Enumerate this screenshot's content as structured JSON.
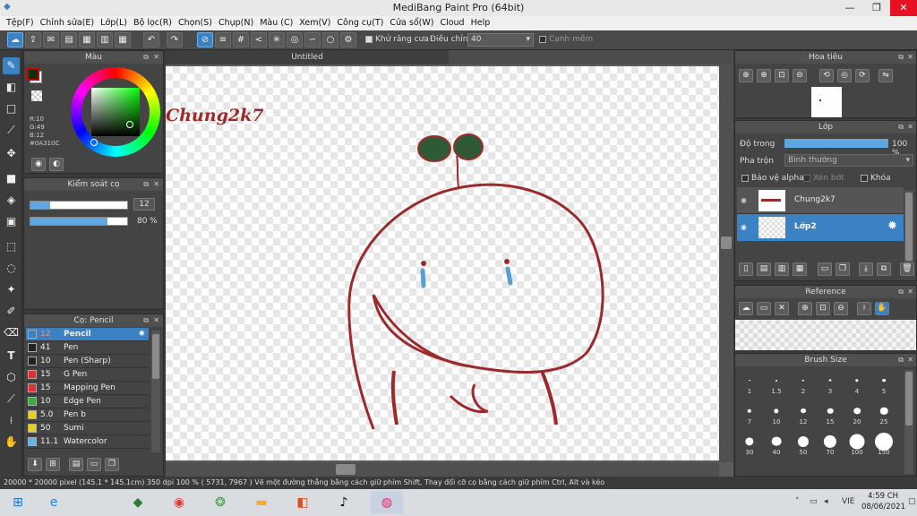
{
  "window": {
    "title": "MediBang Paint Pro (64bit)"
  },
  "menu": [
    "Tệp(F)",
    "Chỉnh sửa(E)",
    "Lớp(L)",
    "Bộ lọc(R)",
    "Chọn(S)",
    "Chụp(N)",
    "Màu (C)",
    "Xem(V)",
    "Công cụ(T)",
    "Cửa sổ(W)",
    "Cloud",
    "Help"
  ],
  "toolbar": {
    "antialias_label": "Khử răng cưa",
    "adjust_label": "Điều chỉnh",
    "adjust_value": "40",
    "smooth_label": "Cạnh mềm"
  },
  "color_panel": {
    "title": "Màu",
    "r": "R:10",
    "g": "G:49",
    "b": "B:12",
    "hex": "#0A310C"
  },
  "brush_control": {
    "title": "Kiểm soát cọ",
    "size": "12",
    "opacity": "80",
    "opacity_unit": "%",
    "size_fill": 0.2,
    "opacity_fill": 0.8
  },
  "brush_panel": {
    "title": "Cọ: Pencil",
    "items": [
      {
        "num": "12",
        "name": "Pencil",
        "color": "#3b82c4"
      },
      {
        "num": "41",
        "name": "Pen",
        "color": "#222222"
      },
      {
        "num": "10",
        "name": "Pen (Sharp)",
        "color": "#222222"
      },
      {
        "num": "15",
        "name": "G Pen",
        "color": "#e03030"
      },
      {
        "num": "15",
        "name": "Mapping Pen",
        "color": "#e03030"
      },
      {
        "num": "10",
        "name": "Edge Pen",
        "color": "#3ab03a"
      },
      {
        "num": "5.0",
        "name": "Pen b",
        "color": "#e8d020"
      },
      {
        "num": "50",
        "name": "Sumi",
        "color": "#e8d020"
      },
      {
        "num": "11.1",
        "name": "Watercolor",
        "color": "#5fb5e8"
      }
    ]
  },
  "canvas": {
    "tab": "Untitled",
    "signature": "Chung2k7"
  },
  "navigator": {
    "title": "Hoa tiêu"
  },
  "layer_panel": {
    "title": "Lớp",
    "opacity_label": "Độ trong",
    "opacity_value": "100 %",
    "opacity_fill": 1.0,
    "blend_label": "Pha trộn",
    "blend_value": "Bình thường",
    "protect_alpha": "Bảo vệ alpha",
    "clipping": "Xén bớt",
    "lock": "Khóa",
    "layers": [
      "Chung2k7",
      "Lớp2"
    ]
  },
  "reference_panel": {
    "title": "Reference"
  },
  "brush_size_panel": {
    "title": "Brush Size",
    "sizes": [
      "1",
      "1.5",
      "2",
      "3",
      "4",
      "5",
      "7",
      "10",
      "12",
      "15",
      "20",
      "25",
      "30",
      "40",
      "50",
      "70",
      "100",
      "150"
    ]
  },
  "status": {
    "text": "20000 * 20000 pixel   (145.1 * 145.1cm)   350 dpi   100 %   ( 5731, 7967 )   Vẽ một đường thẳng bằng cách giữ phím Shift, Thay đổi cỡ cọ bằng cách giữ phím Ctrl, Alt và kéo"
  },
  "taskbar": {
    "lang": "VIE",
    "time": "4:59 CH",
    "date": "08/06/2021"
  },
  "colors": {
    "accent": "#3b82c4",
    "stroke": "#9b2a2a",
    "leaf": "#2f5a36",
    "tear": "#5a9fd4"
  }
}
